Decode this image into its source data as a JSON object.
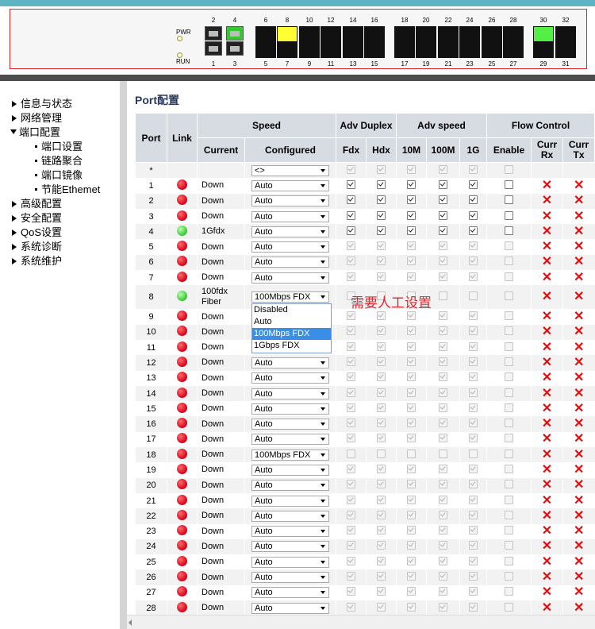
{
  "device": {
    "top_port_numbers": [
      "2",
      "4",
      "6",
      "8",
      "10",
      "12",
      "14",
      "16",
      "18",
      "20",
      "22",
      "24",
      "26",
      "28",
      "30",
      "32"
    ],
    "bottom_port_numbers": [
      "1",
      "3",
      "5",
      "7",
      "9",
      "11",
      "13",
      "15",
      "17",
      "19",
      "21",
      "23",
      "25",
      "27",
      "29",
      "31"
    ],
    "pwr_label": "PWR",
    "run_label": "RUN",
    "highlight_yellow": "#ffff33",
    "highlight_green": "#55ee44"
  },
  "menu": [
    {
      "label": "信息与状态",
      "type": "collapsed"
    },
    {
      "label": "网络管理",
      "type": "collapsed"
    },
    {
      "label": "端口配置",
      "type": "expanded"
    },
    {
      "label": "端口设置",
      "type": "child"
    },
    {
      "label": "链路聚合",
      "type": "child"
    },
    {
      "label": "端口镜像",
      "type": "child"
    },
    {
      "label": "节能Ethemet",
      "type": "child"
    },
    {
      "label": "高级配置",
      "type": "collapsed"
    },
    {
      "label": "安全配置",
      "type": "collapsed"
    },
    {
      "label": "QoS设置",
      "type": "collapsed"
    },
    {
      "label": "系统诊断",
      "type": "collapsed"
    },
    {
      "label": "系统维护",
      "type": "collapsed"
    }
  ],
  "page": {
    "title": "Port配置",
    "annotation": "需要人工设置"
  },
  "table": {
    "headers": {
      "port": "Port",
      "link": "Link",
      "speed": "Speed",
      "adv_duplex": "Adv Duplex",
      "adv_speed": "Adv speed",
      "flow_control": "Flow Control",
      "current": "Current",
      "configured": "Configured",
      "fdx": "Fdx",
      "hdx": "Hdx",
      "s10m": "10M",
      "s100m": "100M",
      "s1g": "1G",
      "enable": "Enable",
      "curr_rx": "Curr Rx",
      "curr_tx": "Curr Tx"
    },
    "wildcard": {
      "port": "*",
      "configured": "<>"
    },
    "rows": [
      {
        "port": "1",
        "link": "down",
        "current": "Down",
        "configured": "Auto",
        "adv": [
          1,
          1,
          1,
          1,
          1
        ],
        "dis": false
      },
      {
        "port": "2",
        "link": "down",
        "current": "Down",
        "configured": "Auto",
        "adv": [
          1,
          1,
          1,
          1,
          1
        ],
        "dis": false
      },
      {
        "port": "3",
        "link": "down",
        "current": "Down",
        "configured": "Auto",
        "adv": [
          1,
          1,
          1,
          1,
          1
        ],
        "dis": false
      },
      {
        "port": "4",
        "link": "up",
        "current": "1Gfdx",
        "configured": "Auto",
        "adv": [
          1,
          1,
          1,
          1,
          1
        ],
        "dis": false
      },
      {
        "port": "5",
        "link": "down",
        "current": "Down",
        "configured": "Auto",
        "adv": [
          1,
          1,
          1,
          1,
          1
        ],
        "dis": true
      },
      {
        "port": "6",
        "link": "down",
        "current": "Down",
        "configured": "Auto",
        "adv": [
          1,
          1,
          1,
          1,
          1
        ],
        "dis": true
      },
      {
        "port": "7",
        "link": "down",
        "current": "Down",
        "configured": "Auto",
        "adv": [
          1,
          1,
          1,
          1,
          1
        ],
        "dis": true
      },
      {
        "port": "8",
        "link": "up",
        "current": "100fdx\nFiber",
        "configured": "100Mbps FDX",
        "adv": [
          0,
          0,
          0,
          0,
          0
        ],
        "dis": true
      },
      {
        "port": "9",
        "link": "down",
        "current": "Down",
        "configured": "Auto",
        "adv": [
          1,
          1,
          1,
          1,
          1
        ],
        "dis": true
      },
      {
        "port": "10",
        "link": "down",
        "current": "Down",
        "configured": "Auto",
        "adv": [
          1,
          1,
          1,
          1,
          1
        ],
        "dis": true
      },
      {
        "port": "11",
        "link": "down",
        "current": "Down",
        "configured": "Auto",
        "adv": [
          1,
          1,
          1,
          1,
          1
        ],
        "dis": true
      },
      {
        "port": "12",
        "link": "down",
        "current": "Down",
        "configured": "Auto",
        "adv": [
          1,
          1,
          1,
          1,
          1
        ],
        "dis": true
      },
      {
        "port": "13",
        "link": "down",
        "current": "Down",
        "configured": "Auto",
        "adv": [
          1,
          1,
          1,
          1,
          1
        ],
        "dis": true
      },
      {
        "port": "14",
        "link": "down",
        "current": "Down",
        "configured": "Auto",
        "adv": [
          1,
          1,
          1,
          1,
          1
        ],
        "dis": true
      },
      {
        "port": "15",
        "link": "down",
        "current": "Down",
        "configured": "Auto",
        "adv": [
          1,
          1,
          1,
          1,
          1
        ],
        "dis": true
      },
      {
        "port": "16",
        "link": "down",
        "current": "Down",
        "configured": "Auto",
        "adv": [
          1,
          1,
          1,
          1,
          1
        ],
        "dis": true
      },
      {
        "port": "17",
        "link": "down",
        "current": "Down",
        "configured": "Auto",
        "adv": [
          1,
          1,
          1,
          1,
          1
        ],
        "dis": true
      },
      {
        "port": "18",
        "link": "down",
        "current": "Down",
        "configured": "100Mbps FDX",
        "adv": [
          0,
          0,
          0,
          0,
          0
        ],
        "dis": true
      },
      {
        "port": "19",
        "link": "down",
        "current": "Down",
        "configured": "Auto",
        "adv": [
          1,
          1,
          1,
          1,
          1
        ],
        "dis": true
      },
      {
        "port": "20",
        "link": "down",
        "current": "Down",
        "configured": "Auto",
        "adv": [
          1,
          1,
          1,
          1,
          1
        ],
        "dis": true
      },
      {
        "port": "21",
        "link": "down",
        "current": "Down",
        "configured": "Auto",
        "adv": [
          1,
          1,
          1,
          1,
          1
        ],
        "dis": true
      },
      {
        "port": "22",
        "link": "down",
        "current": "Down",
        "configured": "Auto",
        "adv": [
          1,
          1,
          1,
          1,
          1
        ],
        "dis": true
      },
      {
        "port": "23",
        "link": "down",
        "current": "Down",
        "configured": "Auto",
        "adv": [
          1,
          1,
          1,
          1,
          1
        ],
        "dis": true
      },
      {
        "port": "24",
        "link": "down",
        "current": "Down",
        "configured": "Auto",
        "adv": [
          1,
          1,
          1,
          1,
          1
        ],
        "dis": true
      },
      {
        "port": "25",
        "link": "down",
        "current": "Down",
        "configured": "Auto",
        "adv": [
          1,
          1,
          1,
          1,
          1
        ],
        "dis": true
      },
      {
        "port": "26",
        "link": "down",
        "current": "Down",
        "configured": "Auto",
        "adv": [
          1,
          1,
          1,
          1,
          1
        ],
        "dis": true
      },
      {
        "port": "27",
        "link": "down",
        "current": "Down",
        "configured": "Auto",
        "adv": [
          1,
          1,
          1,
          1,
          1
        ],
        "dis": true
      },
      {
        "port": "28",
        "link": "down",
        "current": "Down",
        "configured": "Auto",
        "adv": [
          1,
          1,
          1,
          1,
          1
        ],
        "dis": true
      }
    ]
  },
  "dropdown_options": [
    "Disabled",
    "Auto",
    "100Mbps FDX",
    "1Gbps FDX"
  ],
  "dropdown_selected": "100Mbps FDX"
}
